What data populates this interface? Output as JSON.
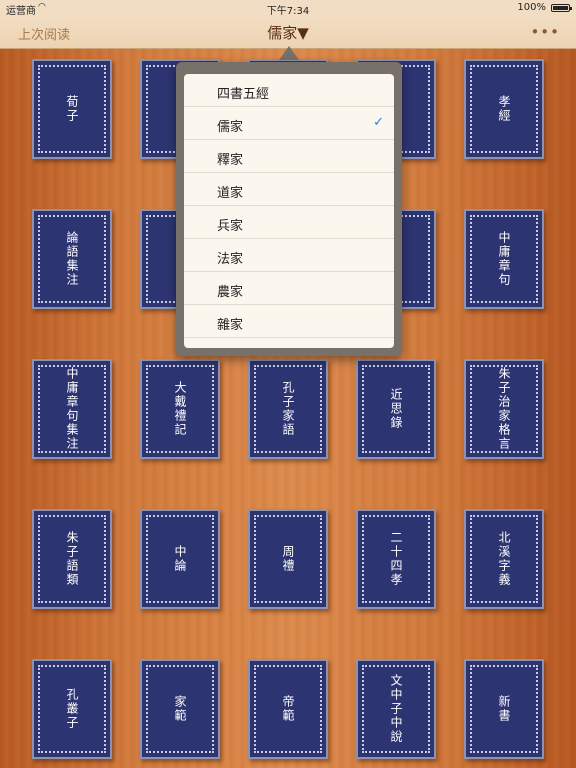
{
  "status_bar": {
    "carrier": "运营商",
    "wifi_icon": "wifi-icon",
    "time": "下午7:34",
    "battery": "100%"
  },
  "nav": {
    "back_label": "上次阅读",
    "title": "儒家▼",
    "more_label": "•••"
  },
  "popover": {
    "selected": "儒家",
    "items": [
      "四書五經",
      "儒家",
      "釋家",
      "道家",
      "兵家",
      "法家",
      "農家",
      "雜家"
    ]
  },
  "books": [
    [
      "荀子",
      "",
      "",
      "",
      "孝經"
    ],
    [
      "論語集注",
      "",
      "",
      "",
      "中庸章句"
    ],
    [
      "中庸章句集注",
      "大戴禮記",
      "孔子家語",
      "近思錄",
      "朱子治家格言"
    ],
    [
      "朱子語類",
      "中論",
      "周禮",
      "二十四孝",
      "北溪字義"
    ],
    [
      "孔叢子",
      "家範",
      "帝範",
      "文中子中說",
      "新書"
    ]
  ],
  "colors": {
    "book_cover": "#2d3472",
    "check_mark": "#2f7be8",
    "popover_frame": "#77716a"
  }
}
